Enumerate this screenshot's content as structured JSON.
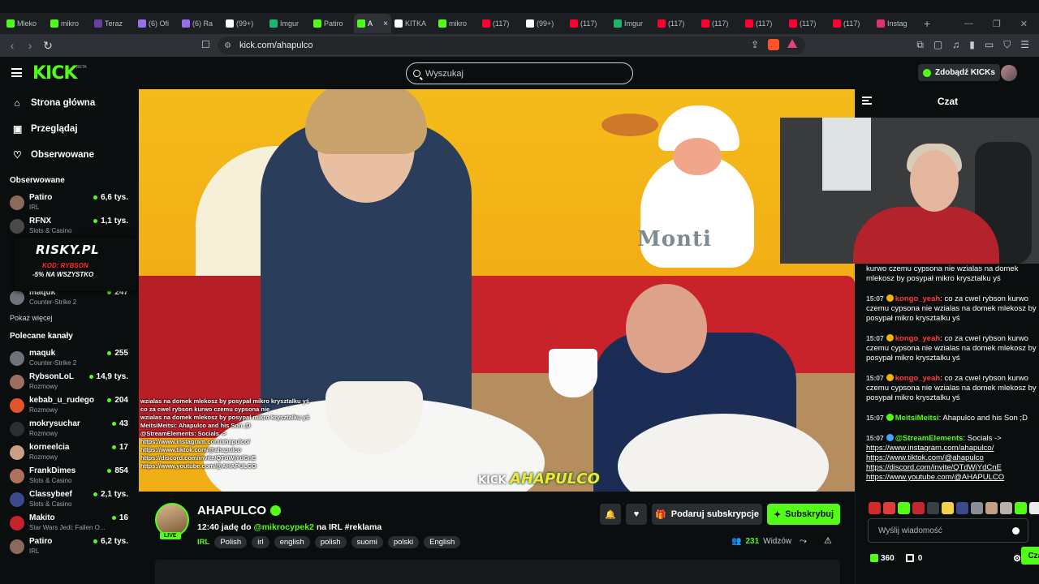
{
  "browser": {
    "tabs": [
      {
        "title": "Mleko",
        "color": "#53fc18"
      },
      {
        "title": "mikro",
        "color": "#53fc18"
      },
      {
        "title": "Teraz",
        "color": "#6b3fa0"
      },
      {
        "title": "(6) Ofi",
        "color": "#9b6cf0"
      },
      {
        "title": "(6) Ra",
        "color": "#9b6cf0"
      },
      {
        "title": "(99+)",
        "color": "#ffffff"
      },
      {
        "title": "Imgur",
        "color": "#1bb76e"
      },
      {
        "title": "Patiro",
        "color": "#53fc18"
      },
      {
        "title": "A",
        "color": "#53fc18",
        "active": true
      },
      {
        "title": "KITKA",
        "color": "#ffffff"
      },
      {
        "title": "mikro",
        "color": "#53fc18"
      },
      {
        "title": "(117)",
        "color": "#ff0033"
      },
      {
        "title": "(99+)",
        "color": "#ffffff"
      },
      {
        "title": "(117)",
        "color": "#ff0033"
      },
      {
        "title": "Imgur",
        "color": "#1bb76e"
      },
      {
        "title": "(117)",
        "color": "#ff0033"
      },
      {
        "title": "(117)",
        "color": "#ff0033"
      },
      {
        "title": "(117)",
        "color": "#ff0033"
      },
      {
        "title": "(117)",
        "color": "#ff0033"
      },
      {
        "title": "(117)",
        "color": "#ff0033"
      },
      {
        "title": "Instag",
        "color": "#e1306c"
      }
    ],
    "url": "kick.com/ahapulco"
  },
  "header": {
    "logo": "KICK",
    "beta": "BETA",
    "search_placeholder": "Wyszukaj",
    "kicks_button": "Zdobądź KICKs"
  },
  "sidebar": {
    "nav": [
      {
        "label": "Strona główna",
        "icon": "home-icon",
        "glyph": "⌂"
      },
      {
        "label": "Przeglądaj",
        "icon": "browse-icon",
        "glyph": "▣"
      },
      {
        "label": "Obserwowane",
        "icon": "heart-icon",
        "glyph": "♡"
      }
    ],
    "followed_title": "Obserwowane",
    "followed": [
      {
        "name": "Patiro",
        "category": "IRL",
        "viewers": "6,6 tys.",
        "color": "#8a6b5a"
      },
      {
        "name": "RFNX",
        "category": "Slots & Casino",
        "viewers": "1,1 tys.",
        "color": "#4a4a4a"
      },
      {
        "name": "maquk",
        "category": "Counter-Strike 2",
        "viewers": "247",
        "color": "#6d7379"
      }
    ],
    "promo": {
      "brand": "RISKY.PL",
      "code": "KOD: RYBSON",
      "offer": "-5% NA WSZYSTKO"
    },
    "show_more": "Pokaż więcej",
    "recommended_title": "Polecane kanały",
    "recommended": [
      {
        "name": "maquk",
        "category": "Counter-Strike 2",
        "viewers": "255",
        "color": "#6d7379"
      },
      {
        "name": "RybsonLoL",
        "category": "Rozmowy",
        "viewers": "14,9 tys.",
        "color": "#9a6f5c"
      },
      {
        "name": "kebab_u_rudego",
        "category": "Rozmowy",
        "viewers": "204",
        "color": "#e0552b"
      },
      {
        "name": "mokrysuchar",
        "category": "Rozmowy",
        "viewers": "43",
        "color": "#2b2f33"
      },
      {
        "name": "korneelcia",
        "category": "Rozmowy",
        "viewers": "17",
        "color": "#c9a087"
      },
      {
        "name": "FrankDimes",
        "category": "Slots & Casino",
        "viewers": "854",
        "color": "#b0715a"
      },
      {
        "name": "Classybeef",
        "category": "Slots & Casino",
        "viewers": "2,1 tys.",
        "color": "#3b4a8a"
      },
      {
        "name": "Makito",
        "category": "Star Wars Jedi: Fallen O...",
        "viewers": "16",
        "color": "#c4232a"
      },
      {
        "name": "Patiro",
        "category": "IRL",
        "viewers": "6,2 tys.",
        "color": "#8a6b5a"
      }
    ]
  },
  "video": {
    "overlay_lines": [
      "wzialas na domek mlekosz by posypał mikro krysztalku yś",
      "                      co za cwel rybson kurwo czemu cypsona nie",
      "wzialas na domek mlekosz by posypał mikro krysztalku yś",
      "MeitsiMeitsi: Ahapulco and his Son ;D",
      "@StreamElements: Socials ->",
      "https://www.instagram.com/ahapulco/",
      "https://www.tiktok.com/@ahapulco",
      "https://discord.com/invite/QTdWjYdCnE",
      "https://www.youtube.com/@AHAPULCO"
    ],
    "mural_text": "Monti",
    "watermark_small": "KICK",
    "watermark_big": "AHAPULCO"
  },
  "stream": {
    "name": "AHAPULCO",
    "live": "LIVE",
    "title_prefix": "12:40 jadę do ",
    "title_mention": "@mikrocypek2",
    "title_suffix": " na IRL  #reklama",
    "category": "IRL",
    "tags": [
      "Polish",
      "irl",
      "english",
      "polish",
      "suomi",
      "polski",
      "English"
    ],
    "gift_button": "Podaruj subskrypcje",
    "sub_button": "Subskrybuj",
    "viewers_count": "231",
    "viewers_label": "Widzów"
  },
  "chat": {
    "title": "Czat",
    "messages": [
      {
        "time": "",
        "user": "",
        "user_color": "#ffffff",
        "badge": "",
        "text": "kurwo czemu cypsona nie wzialas na domek mlekosz by posypał mikro krysztalku yś"
      },
      {
        "time": "15:07",
        "user": "kongo_yeah",
        "user_color": "#ff3b3b",
        "badge": "#f5b400",
        "text": ": co za cwel rybson kurwo czemu cypsona nie wzialas na domek mlekosz by posypał mikro krysztalku yś"
      },
      {
        "time": "15:07",
        "user": "kongo_yeah",
        "user_color": "#ff3b3b",
        "badge": "#f5b400",
        "text": ": co za cwel rybson kurwo czemu cypsona nie wzialas na domek mlekosz by posypał mikro krysztalku yś"
      },
      {
        "time": "15:07",
        "user": "kongo_yeah",
        "user_color": "#ff3b3b",
        "badge": "#f5b400",
        "text": ": co za cwel rybson kurwo czemu cypsona nie wzialas na domek mlekosz by posypał mikro krysztalku yś"
      },
      {
        "time": "15:07",
        "user": "MeitsiMeitsi",
        "user_color": "#53fc18",
        "badge": "#53fc18",
        "text": ": Ahapulco and his Son ;D"
      }
    ],
    "se_message": {
      "time": "15:07",
      "user": "@StreamElements",
      "text": ": Socials ->",
      "links": [
        "https://www.instagram.com/ahapulco/",
        "https://www.tiktok.com/@ahapulco",
        "https://discord.com/invite/QTdWjYdCnE",
        "https://www.youtube.com/@AHAPULCO"
      ]
    },
    "emotes": [
      "#d42a2a",
      "#e03c3c",
      "#53fc18",
      "#c2262e",
      "#3a3f44",
      "#f3d24a",
      "#3b4a8a",
      "#8a8e93",
      "#c39f85",
      "#b9b1a8",
      "#53fc18",
      "#eaeaea"
    ],
    "input_placeholder": "Wyślij wiadomość",
    "points": "360",
    "gifts": "0",
    "send_button": "Czat"
  }
}
